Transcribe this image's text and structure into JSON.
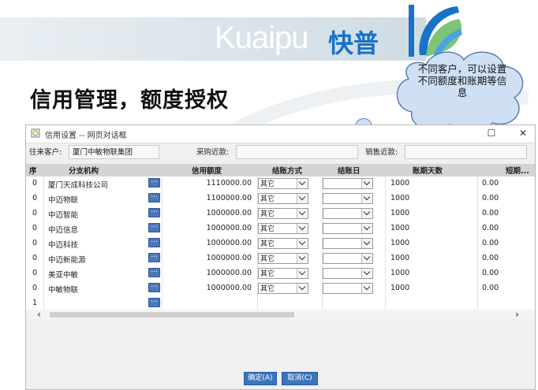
{
  "brand": {
    "logo_text": "Kuaipu",
    "logo_cn": "快普"
  },
  "heading": "信用管理，额度授权",
  "callout": "不同客户，可以设置不同额度和账期等信息",
  "dialog": {
    "title": "信用设置 -- 网页对话框",
    "filters": {
      "customer_label": "往来客户:",
      "customer_value": "厦门中敏物联集团",
      "purchase_label": "采购近款:",
      "sales_label": "销售近款:"
    },
    "columns": [
      "序",
      "分支机构",
      "信用额度",
      "结账方式",
      "结账日",
      "账期天数",
      "短期..."
    ],
    "rows": [
      {
        "seq": "0",
        "branch": "厦门天成科技公司",
        "credit": "1110000.00",
        "method": "其它",
        "days": "1000",
        "short": "0.00"
      },
      {
        "seq": "0",
        "branch": "中迈物联",
        "credit": "1100000.00",
        "method": "其它",
        "days": "1000",
        "short": "0.00"
      },
      {
        "seq": "0",
        "branch": "中迈智能",
        "credit": "1000000.00",
        "method": "其它",
        "days": "1000",
        "short": "0.00"
      },
      {
        "seq": "0",
        "branch": "中迈信息",
        "credit": "1000000.00",
        "method": "其它",
        "days": "1000",
        "short": "0.00"
      },
      {
        "seq": "0",
        "branch": "中迈科技",
        "credit": "1000000.00",
        "method": "其它",
        "days": "1000",
        "short": "0.00"
      },
      {
        "seq": "0",
        "branch": "中迈新能源",
        "credit": "1000000.00",
        "method": "其它",
        "days": "1000",
        "short": "0.00"
      },
      {
        "seq": "0",
        "branch": "美亚中敏",
        "credit": "1000000.00",
        "method": "其它",
        "days": "1000",
        "short": "0.00"
      },
      {
        "seq": "0",
        "branch": "中敏物联",
        "credit": "1000000.00",
        "method": "其它",
        "days": "1000",
        "short": "0.00"
      },
      {
        "seq": "1",
        "branch": "",
        "credit": "",
        "method": "",
        "days": "",
        "short": ""
      }
    ],
    "buttons": {
      "ok": "确定(A)",
      "cancel": "取消(C)"
    },
    "window_controls": {
      "maximize": "☐",
      "close": "✕"
    }
  },
  "colors": {
    "accent": "#3d74c0",
    "logo_blue": "#1a72c8",
    "bubble": "#cfe0f5"
  }
}
